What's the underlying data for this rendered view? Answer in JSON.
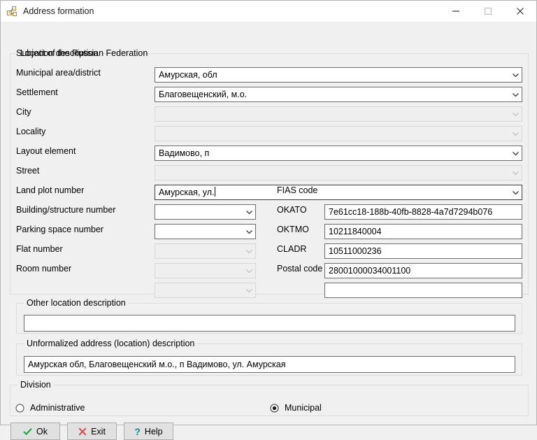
{
  "window": {
    "title": "Address formation",
    "icon": "address-formation-icon",
    "controls": {
      "minimize": "minimize-icon",
      "maximize": "maximize-icon",
      "close": "close-icon"
    }
  },
  "colors": {
    "dialog_bg": "#f0f0f0",
    "titlebar_bg": "#ffffff",
    "field_bg": "#ffffff",
    "field_disabled_bg": "#efefef",
    "field_border": "#6d6d6d",
    "group_border": "#dcdcdc",
    "button_bg": "#e1e1e1",
    "ok_check": "#0f9d3a",
    "exit_x": "#d9483b",
    "help_q": "#0b8f87"
  },
  "groups": {
    "location": {
      "title": "Location description"
    },
    "other": {
      "title": "Other location description"
    },
    "unformalized": {
      "title": "Unformalized address (location) description"
    },
    "division": {
      "title": "Division"
    }
  },
  "location_fields": [
    {
      "label": "Subject of the Russian Federation",
      "value": "Амурская, обл",
      "enabled": true,
      "focused": false
    },
    {
      "label": "Municipal area/district",
      "value": "Благовещенский, м.о.",
      "enabled": true,
      "focused": false
    },
    {
      "label": "Settlement",
      "value": "",
      "enabled": false,
      "focused": false
    },
    {
      "label": "City",
      "value": "",
      "enabled": false,
      "focused": false
    },
    {
      "label": "Locality",
      "value": "Вадимово, п",
      "enabled": true,
      "focused": false
    },
    {
      "label": "Layout element",
      "value": "",
      "enabled": false,
      "focused": false
    },
    {
      "label": "Street",
      "value": "Амурская, ул.",
      "enabled": true,
      "focused": true
    }
  ],
  "number_fields": [
    {
      "label": "Land plot number",
      "value": "",
      "enabled": true
    },
    {
      "label": "Building/structure number",
      "value": "",
      "enabled": true
    },
    {
      "label": "Parking space number",
      "value": "",
      "enabled": false
    },
    {
      "label": "Flat number",
      "value": "",
      "enabled": false
    },
    {
      "label": "Room number",
      "value": "",
      "enabled": false
    }
  ],
  "code_fields": [
    {
      "label": "FIAS code",
      "value": "7e61cc18-188b-40fb-8828-4a7d7294b076"
    },
    {
      "label": "OKATO",
      "value": "10211840004"
    },
    {
      "label": "OKTMO",
      "value": "10511000236"
    },
    {
      "label": "CLADR",
      "value": "28001000034001100"
    },
    {
      "label": "Postal code",
      "value": ""
    }
  ],
  "other_description": {
    "value": ""
  },
  "unformalized_description": {
    "value": "Амурская обл,  Благовещенский м.о.,  п Вадимово,  ул. Амурская"
  },
  "division": {
    "options": [
      {
        "label": "Administrative",
        "selected": false
      },
      {
        "label": "Municipal",
        "selected": true
      }
    ]
  },
  "buttons": [
    {
      "label": "Ok",
      "icon": "check-icon"
    },
    {
      "label": "Exit",
      "icon": "x-icon"
    },
    {
      "label": "Help",
      "icon": "question-icon"
    }
  ]
}
